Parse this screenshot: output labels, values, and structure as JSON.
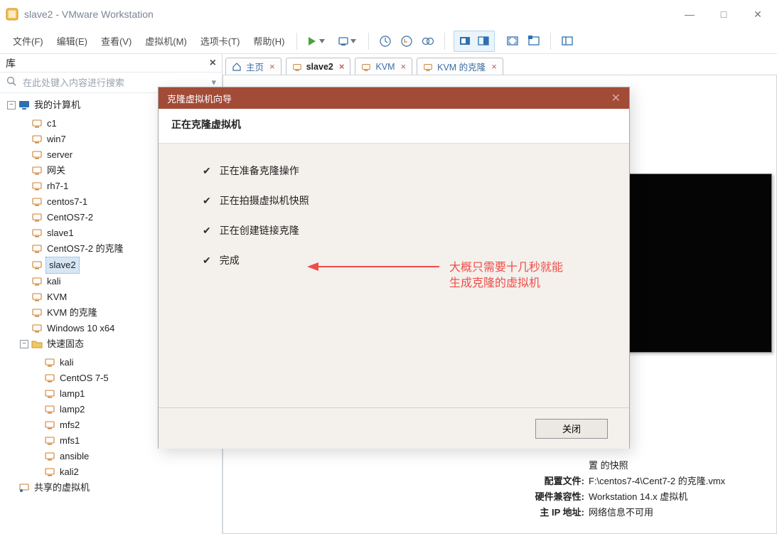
{
  "titlebar": {
    "text": "slave2 - VMware Workstation"
  },
  "menu": {
    "file": "文件(F)",
    "edit": "编辑(E)",
    "view": "查看(V)",
    "vm": "虚拟机(M)",
    "tabs": "选项卡(T)",
    "help": "帮助(H)"
  },
  "sidebar": {
    "header": "库",
    "search_placeholder": "在此处键入内容进行搜索",
    "root": "我的计算机",
    "items": [
      "c1",
      "win7",
      "server",
      "网关",
      "rh7-1",
      "centos7-1",
      "CentOS7-2",
      "slave1",
      "CentOS7-2 的克隆",
      "slave2",
      "kali",
      "KVM",
      "KVM 的克隆",
      "Windows 10 x64"
    ],
    "selected": "slave2",
    "folder": "快速固态",
    "folder_items": [
      "kali",
      "CentOS 7-5",
      "lamp1",
      "lamp2",
      "mfs2",
      "mfs1",
      "ansible",
      "kali2"
    ],
    "shared": "共享的虚拟机"
  },
  "tabs": {
    "home": "主页",
    "items": [
      "slave2",
      "KVM",
      "KVM 的克隆"
    ],
    "active": "slave2"
  },
  "wizard": {
    "title": "克隆虚拟机向导",
    "subheader": "正在克隆虚拟机",
    "steps": [
      "正在准备克隆操作",
      "正在拍摄虚拟机快照",
      "正在创建链接克隆",
      "完成"
    ],
    "close_btn": "关闭"
  },
  "annotation": {
    "line1": "大概只需要十几秒就能",
    "line2": "生成克隆的虚拟机"
  },
  "vm_details": {
    "snapshot_label": "置 的快照",
    "config_label": "配置文件:",
    "config_value": "F:\\centos7-4\\Cent7-2 的克隆.vmx",
    "compat_label": "硬件兼容性:",
    "compat_value": "Workstation 14.x 虚拟机",
    "ip_label": "主 IP 地址:",
    "ip_value": "网络信息不可用"
  }
}
